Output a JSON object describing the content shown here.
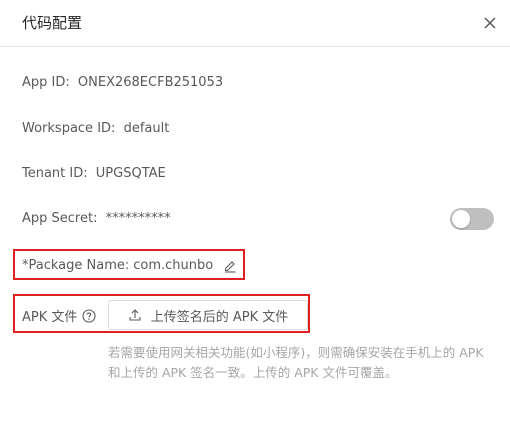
{
  "dialog": {
    "title": "代码配置",
    "close_icon": "close-icon"
  },
  "fields": {
    "app_id": {
      "label": "App ID:",
      "value": "ONEX268ECFB251053"
    },
    "workspace_id": {
      "label": "Workspace ID:",
      "value": "default"
    },
    "tenant_id": {
      "label": "Tenant ID:",
      "value": "UPGSQTAE"
    },
    "app_secret": {
      "label": "App Secret:",
      "value": "**********",
      "toggle_on": false
    },
    "package_name": {
      "label": "*Package Name:",
      "value": "com.chunbo",
      "edit_icon": "edit-icon"
    },
    "apk": {
      "label": "APK 文件",
      "help_icon": "help-circle-icon",
      "upload_label": "上传签名后的 APK 文件",
      "upload_icon": "upload-icon",
      "note": "若需要使用网关相关功能(如小程序)，则需确保安装在手机上的 APK 和上传的 APK 签名一致。上传的 APK 文件可覆盖。"
    }
  },
  "colors": {
    "highlight_border": "#e02020",
    "toggle_off": "#bfbfbf",
    "text": "#595959",
    "note_text": "#a6a6a6"
  }
}
